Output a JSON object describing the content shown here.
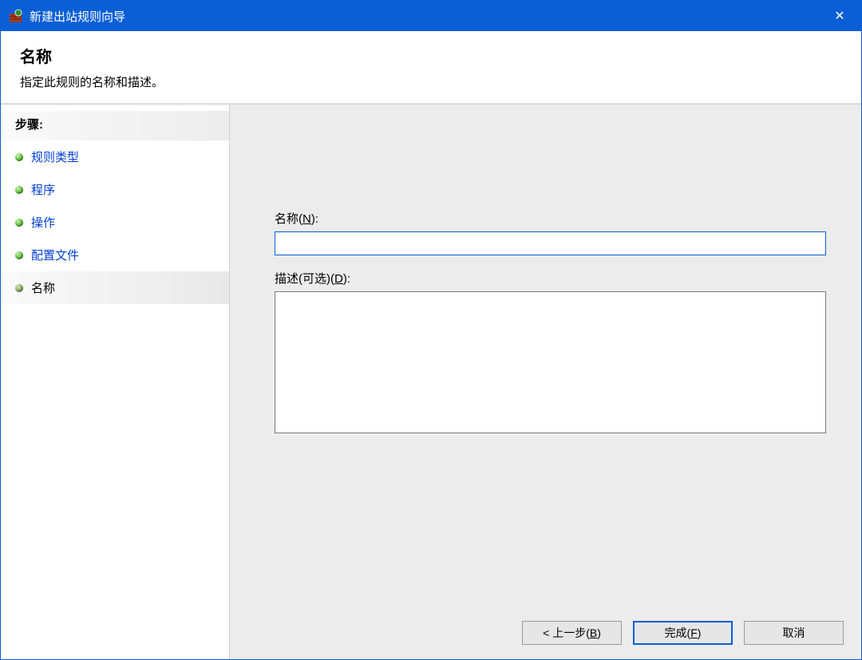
{
  "window": {
    "title": "新建出站规则向导",
    "close_glyph": "✕"
  },
  "header": {
    "title": "名称",
    "subtitle": "指定此规则的名称和描述。"
  },
  "steps": {
    "header": "步骤:",
    "items": [
      {
        "label": "规则类型",
        "current": false
      },
      {
        "label": "程序",
        "current": false
      },
      {
        "label": "操作",
        "current": false
      },
      {
        "label": "配置文件",
        "current": false
      },
      {
        "label": "名称",
        "current": true
      }
    ]
  },
  "form": {
    "name_label_pre": "名称(",
    "name_label_key": "N",
    "name_label_post": "):",
    "name_value": "",
    "desc_label_pre": "描述(可选)(",
    "desc_label_key": "D",
    "desc_label_post": "):",
    "desc_value": ""
  },
  "buttons": {
    "back_pre": "< 上一步(",
    "back_key": "B",
    "back_post": ")",
    "finish_pre": "完成(",
    "finish_key": "F",
    "finish_post": ")",
    "cancel": "取消"
  }
}
